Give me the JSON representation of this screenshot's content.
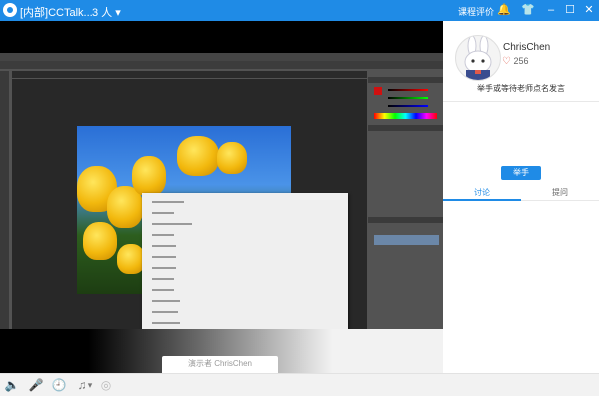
{
  "titlebar": {
    "title": "[内部]CCTalk...",
    "members": "3 人",
    "members_caret": "▾",
    "eval_label": "课程评价",
    "icons": {
      "logo": "cctalk-logo-icon",
      "bell": "bell-icon",
      "skin": "shirt-icon",
      "minimize": "minimize-icon",
      "maximize": "maximize-icon",
      "close": "close-icon"
    },
    "glyphs": {
      "bell": "🔔",
      "skin": "👕",
      "minimize": "–",
      "maximize": "☐",
      "close": "✕"
    }
  },
  "share": {
    "presenter_label": "演示者 ChrisChen"
  },
  "sidebar": {
    "name": "ChrisChen",
    "fans_icon": "♡",
    "fans": "256",
    "hint": "举手或等待老师点名发言",
    "raise_hand": "举手",
    "tabs": [
      {
        "label": "讨论"
      },
      {
        "label": "提问"
      }
    ]
  },
  "toolbar": {
    "glyphs": {
      "speaker": "🔈",
      "mic": "🎤",
      "clock": "🕘",
      "music": "♫",
      "music_caret": "▾",
      "record": "◎"
    }
  },
  "colors": {
    "brand_blue": "#1f8be6",
    "photo_yellow": "#f2b80d"
  }
}
